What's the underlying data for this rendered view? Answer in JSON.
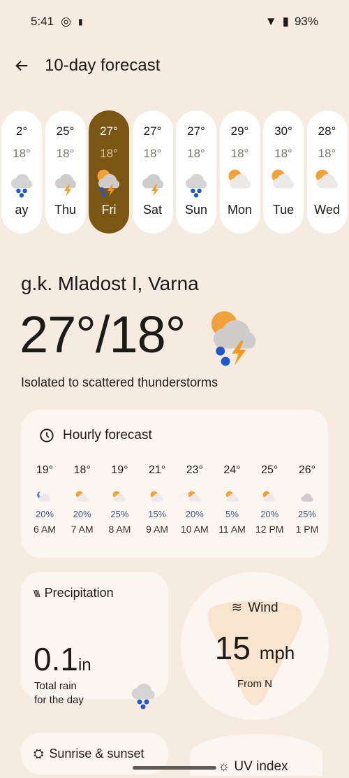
{
  "status": {
    "time": "5:41",
    "battery": "93%"
  },
  "header": {
    "title": "10-day forecast"
  },
  "days": [
    {
      "name": "Wednesday",
      "short": "ay",
      "hi": "2°",
      "lo": "18°",
      "icon": "rain"
    },
    {
      "name": "Thu",
      "hi": "25°",
      "lo": "18°",
      "icon": "storm"
    },
    {
      "name": "Fri",
      "hi": "27°",
      "lo": "18°",
      "icon": "storm-rain",
      "selected": true
    },
    {
      "name": "Sat",
      "hi": "27°",
      "lo": "18°",
      "icon": "storm"
    },
    {
      "name": "Sun",
      "hi": "27°",
      "lo": "18°",
      "icon": "rain"
    },
    {
      "name": "Mon",
      "hi": "29°",
      "lo": "18°",
      "icon": "partly-cloudy"
    },
    {
      "name": "Tue",
      "hi": "30°",
      "lo": "18°",
      "icon": "partly-cloudy"
    },
    {
      "name": "Wed",
      "hi": "28°",
      "lo": "18°",
      "icon": "partly-cloudy"
    }
  ],
  "current": {
    "location": "g.k. Mladost I, Varna",
    "temps": "27°/18°",
    "condition": "Isolated to scattered thunderstorms"
  },
  "hourly": {
    "title": "Hourly forecast",
    "items": [
      {
        "temp": "19°",
        "precip": "20%",
        "time": "6 AM",
        "icon": "night-cloudy"
      },
      {
        "temp": "18°",
        "precip": "20%",
        "time": "7 AM",
        "icon": "partly-cloudy"
      },
      {
        "temp": "19°",
        "precip": "25%",
        "time": "8 AM",
        "icon": "partly-cloudy"
      },
      {
        "temp": "21°",
        "precip": "15%",
        "time": "9 AM",
        "icon": "partly-cloudy"
      },
      {
        "temp": "23°",
        "precip": "20%",
        "time": "10 AM",
        "icon": "partly-cloudy"
      },
      {
        "temp": "24°",
        "precip": "5%",
        "time": "11 AM",
        "icon": "partly-cloudy"
      },
      {
        "temp": "25°",
        "precip": "20%",
        "time": "12 PM",
        "icon": "partly-cloudy"
      },
      {
        "temp": "26°",
        "precip": "25%",
        "time": "1 PM",
        "icon": "cloudy"
      }
    ]
  },
  "precipitation": {
    "title": "Precipitation",
    "value": "0.1",
    "unit": "in",
    "sub1": "Total rain",
    "sub2": "for the day"
  },
  "wind": {
    "title": "Wind",
    "value": "15",
    "unit": "mph",
    "direction": "From N"
  },
  "sunrise": {
    "title": "Sunrise & sunset"
  },
  "uv": {
    "title": "UV index"
  },
  "colors": {
    "background": "#f6ebe1",
    "card": "#fcf6f0",
    "selected_day": "#7b5613",
    "precip_text": "#3c5a8c"
  }
}
